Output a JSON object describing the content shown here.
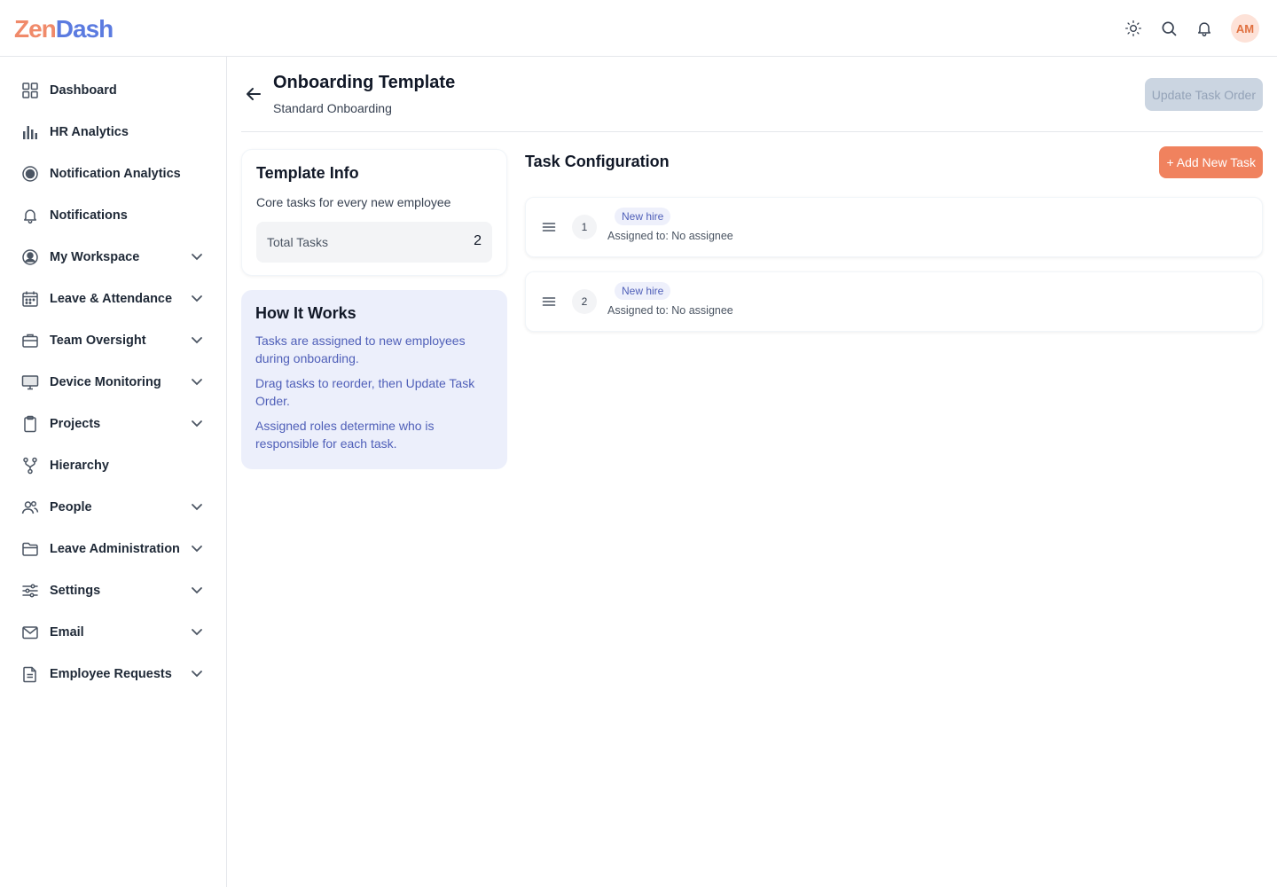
{
  "app": {
    "logo_part1": "Zen",
    "logo_part2": "Dash",
    "user_initials": "AM"
  },
  "header_icons": [
    "sun-icon",
    "search-icon",
    "bell-icon"
  ],
  "sidebar": {
    "items": [
      {
        "label": "Dashboard",
        "icon": "grid-icon",
        "expandable": false
      },
      {
        "label": "HR Analytics",
        "icon": "bar-chart-icon",
        "expandable": false
      },
      {
        "label": "Notification Analytics",
        "icon": "notification-analytics-icon",
        "expandable": false
      },
      {
        "label": "Notifications",
        "icon": "bell-icon",
        "expandable": false
      },
      {
        "label": "My Workspace",
        "icon": "user-circle-icon",
        "expandable": true
      },
      {
        "label": "Leave & Attendance",
        "icon": "calendar-icon",
        "expandable": true
      },
      {
        "label": "Team Oversight",
        "icon": "briefcase-icon",
        "expandable": true
      },
      {
        "label": "Device Monitoring",
        "icon": "monitor-icon",
        "expandable": true
      },
      {
        "label": "Projects",
        "icon": "clipboard-icon",
        "expandable": true
      },
      {
        "label": "Hierarchy",
        "icon": "hierarchy-icon",
        "expandable": false
      },
      {
        "label": "People",
        "icon": "people-icon",
        "expandable": true
      },
      {
        "label": "Leave Administration",
        "icon": "folder-icon",
        "expandable": true
      },
      {
        "label": "Settings",
        "icon": "sliders-icon",
        "expandable": true
      },
      {
        "label": "Email",
        "icon": "mail-icon",
        "expandable": true
      },
      {
        "label": "Employee Requests",
        "icon": "document-icon",
        "expandable": true
      }
    ]
  },
  "page": {
    "title": "Onboarding Template",
    "subtitle": "Standard Onboarding",
    "update_button": "Update Task Order"
  },
  "template_info": {
    "title": "Template Info",
    "description": "Core tasks for every new employee",
    "total_label": "Total Tasks",
    "total_value": "2"
  },
  "how_it_works": {
    "title": "How It Works",
    "items": [
      "Tasks are assigned to new employees during onboarding.",
      "Drag tasks to reorder, then Update Task Order.",
      "Assigned roles determine who is responsible for each task."
    ]
  },
  "task_config": {
    "title": "Task Configuration",
    "add_button": "+ Add New Task",
    "tasks": [
      {
        "number": "1",
        "badge": "New hire",
        "assigned": "Assigned to: No assignee"
      },
      {
        "number": "2",
        "badge": "New hire",
        "assigned": "Assigned to: No assignee"
      }
    ]
  },
  "colors": {
    "accent": "#f0825e",
    "brand_blue": "#5b7be0",
    "info_bg": "#eceffb",
    "info_text": "#4f5fb8"
  }
}
